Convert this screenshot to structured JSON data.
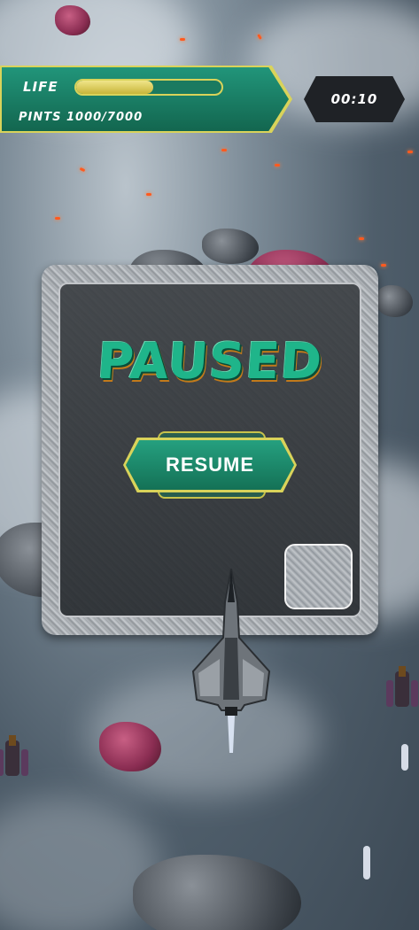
{
  "hud": {
    "life_label": "LIFE",
    "life_level": 0.53,
    "points_label": "PINTS 1000/7000",
    "timer": "00:10"
  },
  "pause_menu": {
    "title": "PAUSED",
    "resume_label": "RESUME"
  },
  "colors": {
    "hud_green": "#1f8a6c",
    "hud_gold": "#d9d35a",
    "title_green": "#1fb58a",
    "timer_bg": "#1f2226"
  },
  "icons": {
    "extra_button": "blank-metal-button"
  }
}
